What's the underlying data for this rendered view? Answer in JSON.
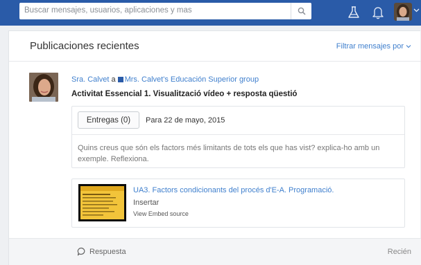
{
  "search": {
    "placeholder": "Buscar mensajes, usuarios, aplicaciones y mas"
  },
  "feed": {
    "title": "Publicaciones recientes",
    "filter_label": "Filtrar mensajes por"
  },
  "post": {
    "author": "Sra. Calvet",
    "connector": "a",
    "group": "Mrs. Calvet's Educación Superior group",
    "title": "Activitat Essencial 1. Visualització vídeo + resposta qüestió",
    "assignment": {
      "button_label": "Entregas (0)",
      "due": "Para 22 de mayo, 2015",
      "body": "Quins creus que són els factors més limitants de tots els que has vist? explica-ho amb un exemple. Reflexiona."
    },
    "embed": {
      "title": "UA3. Factors condicionants del procés d'E-A. Programació.",
      "action": "Insertar",
      "source_link": "View Embed source"
    },
    "reply_label": "Respuesta",
    "time": "Recién"
  },
  "colors": {
    "topbar": "#2a5ba8",
    "link": "#3f7fcd"
  },
  "icons": [
    "search-icon",
    "flask-icon",
    "bell-icon",
    "user-avatar",
    "chevron-down-icon",
    "group-icon",
    "reply-bubble-icon"
  ]
}
